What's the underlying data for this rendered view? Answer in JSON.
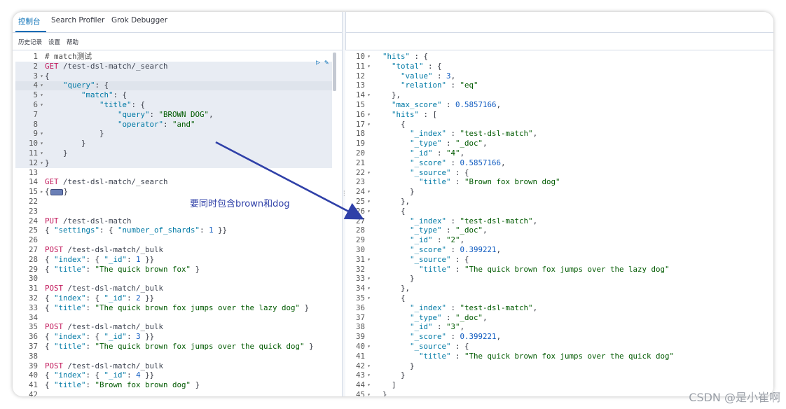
{
  "tabs": [
    {
      "label": "控制台",
      "active": true
    },
    {
      "label": "Search Profiler",
      "active": false
    },
    {
      "label": "Grok Debugger",
      "active": false
    }
  ],
  "toolbar": {
    "history": "历史记录",
    "settings": "设置",
    "help": "帮助"
  },
  "annotation": "要同时包含brown和dog",
  "watermark": "CSDN @是小崔啊",
  "colors": {
    "accent": "#006bb4",
    "arrow": "#2f40a8"
  },
  "left_lines": [
    {
      "n": "1",
      "fold": "",
      "tokens": [
        [
          "c-comment",
          "# match测试"
        ]
      ]
    },
    {
      "n": "2",
      "fold": "",
      "tokens": [
        [
          "c-method",
          "GET"
        ],
        [
          "c-url",
          " /test-dsl-match/_search"
        ]
      ]
    },
    {
      "n": "3",
      "fold": "▾",
      "tokens": [
        [
          "c-punc",
          "{"
        ]
      ]
    },
    {
      "n": "4",
      "fold": "▾",
      "tokens": [
        [
          "c-punc",
          "    "
        ],
        [
          "c-key",
          "\"query\""
        ],
        [
          "c-punc",
          ": {"
        ]
      ]
    },
    {
      "n": "5",
      "fold": "▾",
      "tokens": [
        [
          "c-punc",
          "        "
        ],
        [
          "c-key",
          "\"match\""
        ],
        [
          "c-punc",
          ": {"
        ]
      ]
    },
    {
      "n": "6",
      "fold": "▾",
      "tokens": [
        [
          "c-punc",
          "            "
        ],
        [
          "c-key",
          "\"title\""
        ],
        [
          "c-punc",
          ": {"
        ]
      ]
    },
    {
      "n": "7",
      "fold": "",
      "tokens": [
        [
          "c-punc",
          "                "
        ],
        [
          "c-key",
          "\"query\""
        ],
        [
          "c-punc",
          ": "
        ],
        [
          "c-str",
          "\"BROWN DOG\""
        ],
        [
          "c-punc",
          ","
        ]
      ]
    },
    {
      "n": "8",
      "fold": "",
      "tokens": [
        [
          "c-punc",
          "                "
        ],
        [
          "c-key",
          "\"operator\""
        ],
        [
          "c-punc",
          ": "
        ],
        [
          "c-str",
          "\"and\""
        ]
      ]
    },
    {
      "n": "9",
      "fold": "▾",
      "tokens": [
        [
          "c-punc",
          "            }"
        ]
      ]
    },
    {
      "n": "10",
      "fold": "▾",
      "tokens": [
        [
          "c-punc",
          "        }"
        ]
      ]
    },
    {
      "n": "11",
      "fold": "▾",
      "tokens": [
        [
          "c-punc",
          "    }"
        ]
      ]
    },
    {
      "n": "12",
      "fold": "▾",
      "tokens": [
        [
          "c-punc",
          "}"
        ]
      ]
    },
    {
      "n": "13",
      "fold": "",
      "tokens": []
    },
    {
      "n": "14",
      "fold": "",
      "tokens": [
        [
          "c-method",
          "GET"
        ],
        [
          "c-url",
          " /test-dsl-match/_search"
        ]
      ]
    },
    {
      "n": "15",
      "fold": "▸",
      "tokens": [
        [
          "c-punc",
          "{"
        ],
        [
          "collapsed",
          ""
        ],
        [
          "c-punc",
          "}"
        ]
      ]
    },
    {
      "n": "22",
      "fold": "",
      "tokens": []
    },
    {
      "n": "23",
      "fold": "",
      "tokens": []
    },
    {
      "n": "24",
      "fold": "",
      "tokens": [
        [
          "c-method",
          "PUT"
        ],
        [
          "c-url",
          " /test-dsl-match"
        ]
      ]
    },
    {
      "n": "25",
      "fold": "",
      "tokens": [
        [
          "c-punc",
          "{ "
        ],
        [
          "c-key",
          "\"settings\""
        ],
        [
          "c-punc",
          ": { "
        ],
        [
          "c-key",
          "\"number_of_shards\""
        ],
        [
          "c-punc",
          ": "
        ],
        [
          "c-num",
          "1"
        ],
        [
          "c-punc",
          " }}"
        ]
      ]
    },
    {
      "n": "26",
      "fold": "",
      "tokens": []
    },
    {
      "n": "27",
      "fold": "",
      "tokens": [
        [
          "c-method",
          "POST"
        ],
        [
          "c-url",
          " /test-dsl-match/_bulk"
        ]
      ]
    },
    {
      "n": "28",
      "fold": "",
      "tokens": [
        [
          "c-punc",
          "{ "
        ],
        [
          "c-key",
          "\"index\""
        ],
        [
          "c-punc",
          ": { "
        ],
        [
          "c-key",
          "\"_id\""
        ],
        [
          "c-punc",
          ": "
        ],
        [
          "c-num",
          "1"
        ],
        [
          "c-punc",
          " }}"
        ]
      ]
    },
    {
      "n": "29",
      "fold": "",
      "tokens": [
        [
          "c-punc",
          "{ "
        ],
        [
          "c-key",
          "\"title\""
        ],
        [
          "c-punc",
          ": "
        ],
        [
          "c-str",
          "\"The quick brown fox\""
        ],
        [
          "c-punc",
          " }"
        ]
      ]
    },
    {
      "n": "30",
      "fold": "",
      "tokens": []
    },
    {
      "n": "31",
      "fold": "",
      "tokens": [
        [
          "c-method",
          "POST"
        ],
        [
          "c-url",
          " /test-dsl-match/_bulk"
        ]
      ]
    },
    {
      "n": "32",
      "fold": "",
      "tokens": [
        [
          "c-punc",
          "{ "
        ],
        [
          "c-key",
          "\"index\""
        ],
        [
          "c-punc",
          ": { "
        ],
        [
          "c-key",
          "\"_id\""
        ],
        [
          "c-punc",
          ": "
        ],
        [
          "c-num",
          "2"
        ],
        [
          "c-punc",
          " }}"
        ]
      ]
    },
    {
      "n": "33",
      "fold": "",
      "tokens": [
        [
          "c-punc",
          "{ "
        ],
        [
          "c-key",
          "\"title\""
        ],
        [
          "c-punc",
          ": "
        ],
        [
          "c-str",
          "\"The quick brown fox jumps over the lazy dog\""
        ],
        [
          "c-punc",
          " }"
        ]
      ]
    },
    {
      "n": "34",
      "fold": "",
      "tokens": []
    },
    {
      "n": "35",
      "fold": "",
      "tokens": [
        [
          "c-method",
          "POST"
        ],
        [
          "c-url",
          " /test-dsl-match/_bulk"
        ]
      ]
    },
    {
      "n": "36",
      "fold": "",
      "tokens": [
        [
          "c-punc",
          "{ "
        ],
        [
          "c-key",
          "\"index\""
        ],
        [
          "c-punc",
          ": { "
        ],
        [
          "c-key",
          "\"_id\""
        ],
        [
          "c-punc",
          ": "
        ],
        [
          "c-num",
          "3"
        ],
        [
          "c-punc",
          " }}"
        ]
      ]
    },
    {
      "n": "37",
      "fold": "",
      "tokens": [
        [
          "c-punc",
          "{ "
        ],
        [
          "c-key",
          "\"title\""
        ],
        [
          "c-punc",
          ": "
        ],
        [
          "c-str",
          "\"The quick brown fox jumps over the quick dog\""
        ],
        [
          "c-punc",
          " }"
        ]
      ]
    },
    {
      "n": "38",
      "fold": "",
      "tokens": []
    },
    {
      "n": "39",
      "fold": "",
      "tokens": [
        [
          "c-method",
          "POST"
        ],
        [
          "c-url",
          " /test-dsl-match/_bulk"
        ]
      ]
    },
    {
      "n": "40",
      "fold": "",
      "tokens": [
        [
          "c-punc",
          "{ "
        ],
        [
          "c-key",
          "\"index\""
        ],
        [
          "c-punc",
          ": { "
        ],
        [
          "c-key",
          "\"_id\""
        ],
        [
          "c-punc",
          ": "
        ],
        [
          "c-num",
          "4"
        ],
        [
          "c-punc",
          " }}"
        ]
      ]
    },
    {
      "n": "41",
      "fold": "",
      "tokens": [
        [
          "c-punc",
          "{ "
        ],
        [
          "c-key",
          "\"title\""
        ],
        [
          "c-punc",
          ": "
        ],
        [
          "c-str",
          "\"Brown fox brown dog\""
        ],
        [
          "c-punc",
          " }"
        ]
      ]
    },
    {
      "n": "42",
      "fold": "",
      "tokens": []
    }
  ],
  "right_lines": [
    {
      "n": "10",
      "fold": "▾",
      "tokens": [
        [
          "c-punc",
          "  "
        ],
        [
          "c-key",
          "\"hits\""
        ],
        [
          "c-punc",
          " : {"
        ]
      ]
    },
    {
      "n": "11",
      "fold": "▾",
      "tokens": [
        [
          "c-punc",
          "    "
        ],
        [
          "c-key",
          "\"total\""
        ],
        [
          "c-punc",
          " : {"
        ]
      ]
    },
    {
      "n": "12",
      "fold": "",
      "tokens": [
        [
          "c-punc",
          "      "
        ],
        [
          "c-key",
          "\"value\""
        ],
        [
          "c-punc",
          " : "
        ],
        [
          "c-num",
          "3"
        ],
        [
          "c-punc",
          ","
        ]
      ]
    },
    {
      "n": "13",
      "fold": "",
      "tokens": [
        [
          "c-punc",
          "      "
        ],
        [
          "c-key",
          "\"relation\""
        ],
        [
          "c-punc",
          " : "
        ],
        [
          "c-str",
          "\"eq\""
        ]
      ]
    },
    {
      "n": "14",
      "fold": "▾",
      "tokens": [
        [
          "c-punc",
          "    },"
        ]
      ]
    },
    {
      "n": "15",
      "fold": "",
      "tokens": [
        [
          "c-punc",
          "    "
        ],
        [
          "c-key",
          "\"max_score\""
        ],
        [
          "c-punc",
          " : "
        ],
        [
          "c-num",
          "0.5857166"
        ],
        [
          "c-punc",
          ","
        ]
      ]
    },
    {
      "n": "16",
      "fold": "▾",
      "tokens": [
        [
          "c-punc",
          "    "
        ],
        [
          "c-key",
          "\"hits\""
        ],
        [
          "c-punc",
          " : ["
        ]
      ]
    },
    {
      "n": "17",
      "fold": "▾",
      "tokens": [
        [
          "c-punc",
          "      {"
        ]
      ]
    },
    {
      "n": "18",
      "fold": "",
      "tokens": [
        [
          "c-punc",
          "        "
        ],
        [
          "c-key",
          "\"_index\""
        ],
        [
          "c-punc",
          " : "
        ],
        [
          "c-str",
          "\"test-dsl-match\""
        ],
        [
          "c-punc",
          ","
        ]
      ]
    },
    {
      "n": "19",
      "fold": "",
      "tokens": [
        [
          "c-punc",
          "        "
        ],
        [
          "c-key",
          "\"_type\""
        ],
        [
          "c-punc",
          " : "
        ],
        [
          "c-str",
          "\"_doc\""
        ],
        [
          "c-punc",
          ","
        ]
      ]
    },
    {
      "n": "20",
      "fold": "",
      "tokens": [
        [
          "c-punc",
          "        "
        ],
        [
          "c-key",
          "\"_id\""
        ],
        [
          "c-punc",
          " : "
        ],
        [
          "c-str",
          "\"4\""
        ],
        [
          "c-punc",
          ","
        ]
      ]
    },
    {
      "n": "21",
      "fold": "",
      "tokens": [
        [
          "c-punc",
          "        "
        ],
        [
          "c-key",
          "\"_score\""
        ],
        [
          "c-punc",
          " : "
        ],
        [
          "c-num",
          "0.5857166"
        ],
        [
          "c-punc",
          ","
        ]
      ]
    },
    {
      "n": "22",
      "fold": "▾",
      "tokens": [
        [
          "c-punc",
          "        "
        ],
        [
          "c-key",
          "\"_source\""
        ],
        [
          "c-punc",
          " : {"
        ]
      ]
    },
    {
      "n": "23",
      "fold": "",
      "tokens": [
        [
          "c-punc",
          "          "
        ],
        [
          "c-key",
          "\"title\""
        ],
        [
          "c-punc",
          " : "
        ],
        [
          "c-str",
          "\"Brown fox brown dog\""
        ]
      ]
    },
    {
      "n": "24",
      "fold": "▾",
      "tokens": [
        [
          "c-punc",
          "        }"
        ]
      ]
    },
    {
      "n": "25",
      "fold": "▾",
      "tokens": [
        [
          "c-punc",
          "      },"
        ]
      ]
    },
    {
      "n": "26",
      "fold": "▾",
      "tokens": [
        [
          "c-punc",
          "      {"
        ]
      ]
    },
    {
      "n": "27",
      "fold": "",
      "tokens": [
        [
          "c-punc",
          "        "
        ],
        [
          "c-key",
          "\"_index\""
        ],
        [
          "c-punc",
          " : "
        ],
        [
          "c-str",
          "\"test-dsl-match\""
        ],
        [
          "c-punc",
          ","
        ]
      ]
    },
    {
      "n": "28",
      "fold": "",
      "tokens": [
        [
          "c-punc",
          "        "
        ],
        [
          "c-key",
          "\"_type\""
        ],
        [
          "c-punc",
          " : "
        ],
        [
          "c-str",
          "\"_doc\""
        ],
        [
          "c-punc",
          ","
        ]
      ]
    },
    {
      "n": "29",
      "fold": "",
      "tokens": [
        [
          "c-punc",
          "        "
        ],
        [
          "c-key",
          "\"_id\""
        ],
        [
          "c-punc",
          " : "
        ],
        [
          "c-str",
          "\"2\""
        ],
        [
          "c-punc",
          ","
        ]
      ]
    },
    {
      "n": "30",
      "fold": "",
      "tokens": [
        [
          "c-punc",
          "        "
        ],
        [
          "c-key",
          "\"_score\""
        ],
        [
          "c-punc",
          " : "
        ],
        [
          "c-num",
          "0.399221"
        ],
        [
          "c-punc",
          ","
        ]
      ]
    },
    {
      "n": "31",
      "fold": "▾",
      "tokens": [
        [
          "c-punc",
          "        "
        ],
        [
          "c-key",
          "\"_source\""
        ],
        [
          "c-punc",
          " : {"
        ]
      ]
    },
    {
      "n": "32",
      "fold": "",
      "tokens": [
        [
          "c-punc",
          "          "
        ],
        [
          "c-key",
          "\"title\""
        ],
        [
          "c-punc",
          " : "
        ],
        [
          "c-str",
          "\"The quick brown fox jumps over the lazy dog\""
        ]
      ]
    },
    {
      "n": "33",
      "fold": "▾",
      "tokens": [
        [
          "c-punc",
          "        }"
        ]
      ]
    },
    {
      "n": "34",
      "fold": "▾",
      "tokens": [
        [
          "c-punc",
          "      },"
        ]
      ]
    },
    {
      "n": "35",
      "fold": "▾",
      "tokens": [
        [
          "c-punc",
          "      {"
        ]
      ]
    },
    {
      "n": "36",
      "fold": "",
      "tokens": [
        [
          "c-punc",
          "        "
        ],
        [
          "c-key",
          "\"_index\""
        ],
        [
          "c-punc",
          " : "
        ],
        [
          "c-str",
          "\"test-dsl-match\""
        ],
        [
          "c-punc",
          ","
        ]
      ]
    },
    {
      "n": "37",
      "fold": "",
      "tokens": [
        [
          "c-punc",
          "        "
        ],
        [
          "c-key",
          "\"_type\""
        ],
        [
          "c-punc",
          " : "
        ],
        [
          "c-str",
          "\"_doc\""
        ],
        [
          "c-punc",
          ","
        ]
      ]
    },
    {
      "n": "38",
      "fold": "",
      "tokens": [
        [
          "c-punc",
          "        "
        ],
        [
          "c-key",
          "\"_id\""
        ],
        [
          "c-punc",
          " : "
        ],
        [
          "c-str",
          "\"3\""
        ],
        [
          "c-punc",
          ","
        ]
      ]
    },
    {
      "n": "39",
      "fold": "",
      "tokens": [
        [
          "c-punc",
          "        "
        ],
        [
          "c-key",
          "\"_score\""
        ],
        [
          "c-punc",
          " : "
        ],
        [
          "c-num",
          "0.399221"
        ],
        [
          "c-punc",
          ","
        ]
      ]
    },
    {
      "n": "40",
      "fold": "▾",
      "tokens": [
        [
          "c-punc",
          "        "
        ],
        [
          "c-key",
          "\"_source\""
        ],
        [
          "c-punc",
          " : {"
        ]
      ]
    },
    {
      "n": "41",
      "fold": "",
      "tokens": [
        [
          "c-punc",
          "          "
        ],
        [
          "c-key",
          "\"title\""
        ],
        [
          "c-punc",
          " : "
        ],
        [
          "c-str",
          "\"The quick brown fox jumps over the quick dog\""
        ]
      ]
    },
    {
      "n": "42",
      "fold": "▾",
      "tokens": [
        [
          "c-punc",
          "        }"
        ]
      ]
    },
    {
      "n": "43",
      "fold": "▾",
      "tokens": [
        [
          "c-punc",
          "      }"
        ]
      ]
    },
    {
      "n": "44",
      "fold": "▾",
      "tokens": [
        [
          "c-punc",
          "    ]"
        ]
      ]
    },
    {
      "n": "45",
      "fold": "▾",
      "tokens": [
        [
          "c-punc",
          "  }"
        ]
      ]
    }
  ]
}
